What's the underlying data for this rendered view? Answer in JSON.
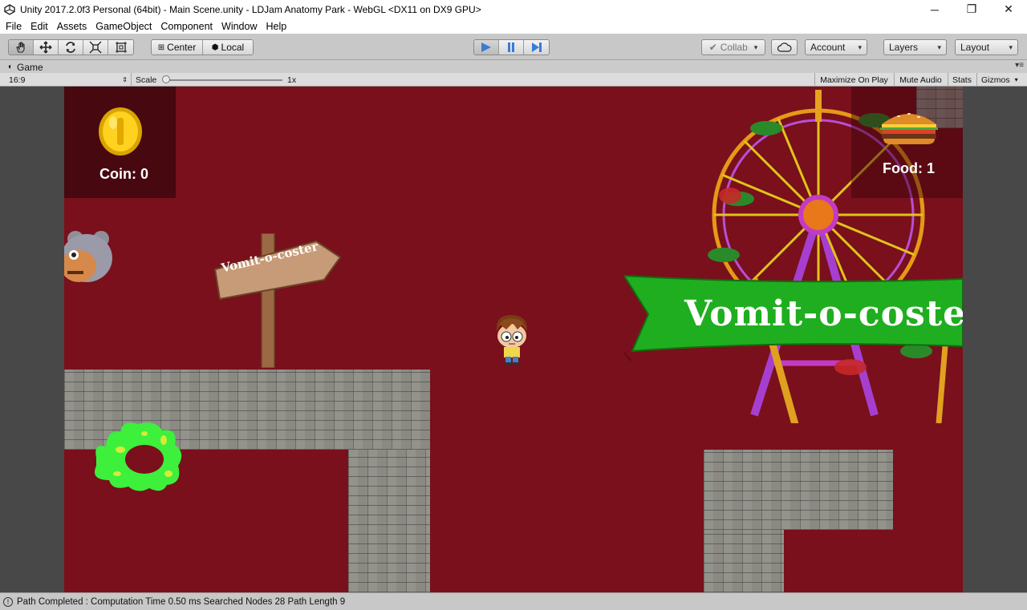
{
  "window": {
    "title": "Unity 2017.2.0f3 Personal (64bit) - Main Scene.unity - LDJam Anatomy Park - WebGL <DX11 on DX9 GPU>",
    "controls": [
      "minimize-icon",
      "restore-icon",
      "close-icon"
    ]
  },
  "menu": {
    "items": [
      "File",
      "Edit",
      "Assets",
      "GameObject",
      "Component",
      "Window",
      "Help"
    ]
  },
  "toolbar": {
    "tools": [
      "hand-icon",
      "move-icon",
      "rotate-icon",
      "scale-icon",
      "rect-tool-icon"
    ],
    "pivot_label": "Center",
    "space_label": "Local",
    "play_controls": [
      "play-icon",
      "pause-icon",
      "step-icon"
    ],
    "collab_label": "Collab",
    "account_label": "Account",
    "layers_label": "Layers",
    "layout_label": "Layout"
  },
  "game_tab": {
    "label": "Game",
    "aspect": "16:9",
    "scale_label": "Scale",
    "scale_value": "1x",
    "maximize_on_play": "Maximize On Play",
    "mute_audio": "Mute Audio",
    "stats": "Stats",
    "gizmos": "Gizmos"
  },
  "game": {
    "coin_label": "Coin: 0",
    "food_label": "Food: 1",
    "sign_text": "Vomit-o-coster",
    "banner_text": "Vomit-o-coste"
  },
  "status": {
    "message": "Path Completed : Computation Time 0.50 ms Searched Nodes 28 Path Length 9"
  },
  "colors": {
    "game_background": "#79101c",
    "banner_green": "#1fae1f",
    "slime_green": "#3cf03c",
    "play_active_blue": "#3a7bd5"
  }
}
